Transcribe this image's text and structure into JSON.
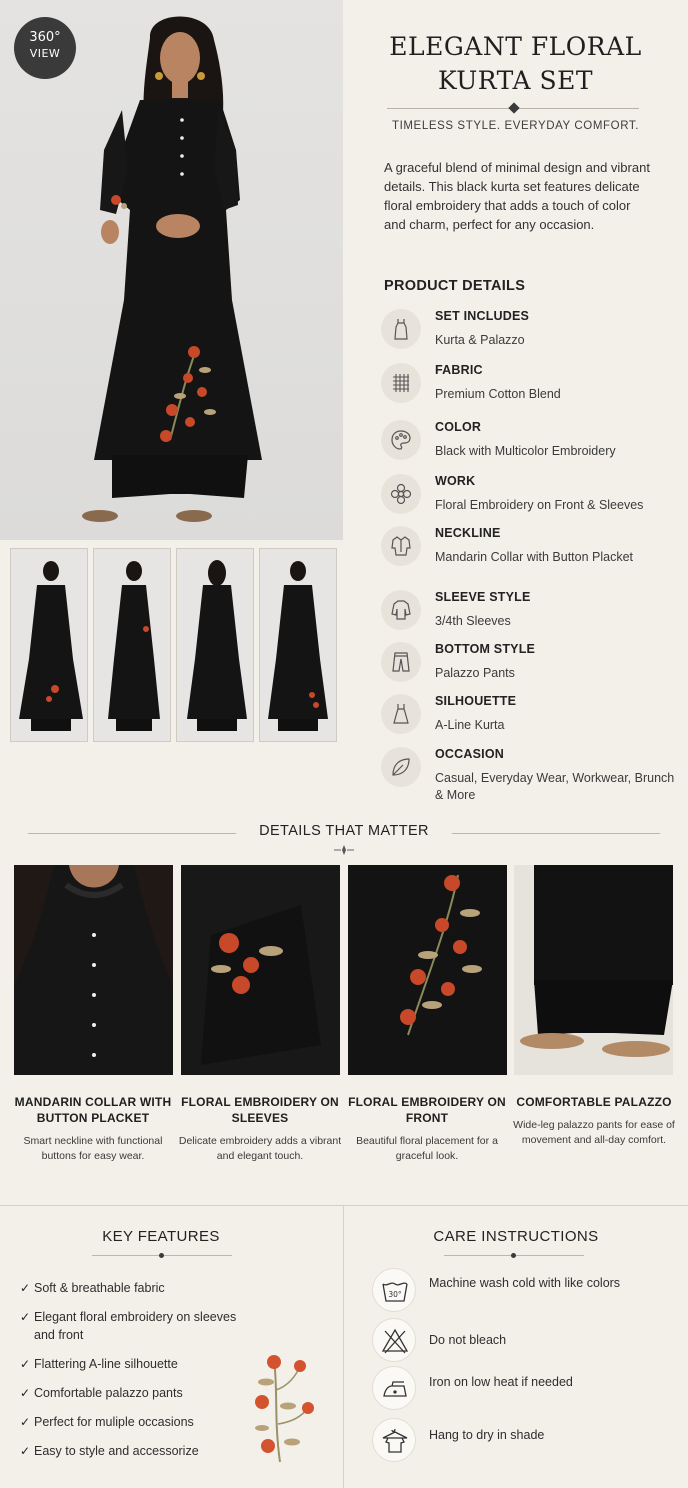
{
  "badge": {
    "number": "360°",
    "label": "VIEW"
  },
  "product": {
    "title_line1": "ELEGANT FLORAL",
    "title_line2": "KURTA SET",
    "tagline": "TIMELESS STYLE. EVERYDAY COMFORT.",
    "description": "A graceful blend of minimal design and vibrant details. This black kurta set features delicate floral embroidery that adds a touch of color and charm, perfect for any occasion."
  },
  "product_details": {
    "heading": "PRODUCT DETAILS",
    "items": [
      {
        "label": "SET INCLUDES",
        "value": "Kurta & Palazzo",
        "icon": "dress-icon"
      },
      {
        "label": "FABRIC",
        "value": "Premium Cotton Blend",
        "icon": "fabric-weave-icon"
      },
      {
        "label": "COLOR",
        "value": "Black with Multicolor Embroidery",
        "icon": "palette-icon"
      },
      {
        "label": "WORK",
        "value": "Floral Embroidery on Front & Sleeves",
        "icon": "flower-icon"
      },
      {
        "label": "NECKLINE",
        "value": "Mandarin Collar with Button Placket",
        "icon": "shirt-collar-icon"
      },
      {
        "label": "SLEEVE STYLE",
        "value": "3/4th Sleeves",
        "icon": "sleeve-icon"
      },
      {
        "label": "BOTTOM STYLE",
        "value": "Palazzo Pants",
        "icon": "pants-icon"
      },
      {
        "label": "SILHOUETTE",
        "value": "A-Line Kurta",
        "icon": "a-line-dress-icon"
      },
      {
        "label": "OCCASION",
        "value": "Casual, Everyday Wear, Workwear, Brunch & More",
        "icon": "leaf-icon"
      }
    ]
  },
  "details_that_matter": {
    "heading": "DETAILS THAT MATTER",
    "items": [
      {
        "title": "MANDARIN COLLAR WITH BUTTON PLACKET",
        "text": "Smart neckline with functional buttons for easy wear."
      },
      {
        "title": "FLORAL EMBROIDERY ON SLEEVES",
        "text": "Delicate embroidery adds a vibrant and elegant touch."
      },
      {
        "title": "FLORAL EMBROIDERY ON FRONT",
        "text": "Beautiful floral placement for a graceful look."
      },
      {
        "title": "COMFORTABLE PALAZZO",
        "text": "Wide-leg palazzo pants for ease of movement and all-day comfort."
      }
    ]
  },
  "key_features": {
    "heading": "KEY FEATURES",
    "check_icon": "✓",
    "items": [
      "Soft & breathable fabric",
      "Elegant floral embroidery on sleeves and front",
      "Flattering A-line silhouette",
      "Comfortable palazzo pants",
      "Perfect for muliple occasions",
      "Easy to style and accessorize"
    ]
  },
  "care_instructions": {
    "heading": "CARE INSTRUCTIONS",
    "items": [
      {
        "text": "Machine wash cold with like colors",
        "icon": "wash-30-icon",
        "icon_text": "30°"
      },
      {
        "text": "Do not bleach",
        "icon": "no-bleach-icon"
      },
      {
        "text": "Iron on low heat if needed",
        "icon": "iron-icon"
      },
      {
        "text": "Hang to dry in shade",
        "icon": "hang-dry-icon"
      }
    ]
  },
  "colors": {
    "background": "#f3f0ea",
    "kurta": "#141414",
    "embroidery_red": "#c8482a",
    "embroidery_gold": "#b7a27a",
    "icon_circle": "#e8e3da"
  }
}
